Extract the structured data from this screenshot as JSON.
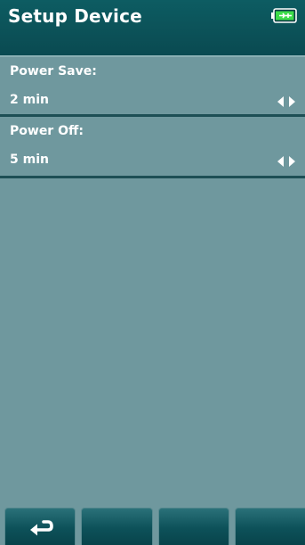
{
  "header": {
    "title": "Setup Device",
    "battery_icon": "battery-charging-icon",
    "battery_color": "#3ddc4a"
  },
  "settings": [
    {
      "label": "Power Save:",
      "value": "2 min",
      "control_icon": "left-right-arrows-icon"
    },
    {
      "label": "Power Off:",
      "value": "5 min",
      "control_icon": "left-right-arrows-icon"
    }
  ],
  "footer": {
    "softkeys": [
      {
        "icon": "return-arrow-icon",
        "label": ""
      },
      {
        "icon": "",
        "label": ""
      },
      {
        "icon": "",
        "label": ""
      },
      {
        "icon": "",
        "label": ""
      }
    ]
  },
  "colors": {
    "header_bg": "#0a4a51",
    "body_bg": "#6f989e",
    "divider": "#1d4f55",
    "text": "#ffffff"
  }
}
